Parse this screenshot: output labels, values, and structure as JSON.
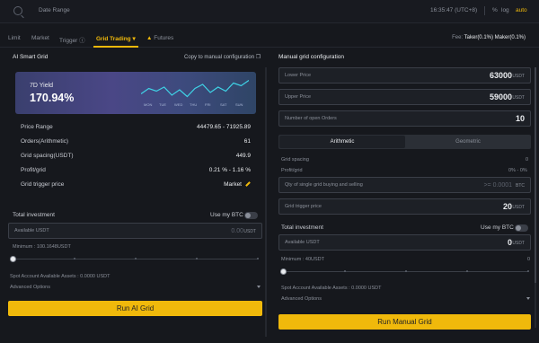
{
  "topbar": {
    "date_range": "Date Range",
    "time": "16:35:47 (UTC+8)",
    "pct": "%",
    "log": "log",
    "auto": "auto"
  },
  "tabs": [
    {
      "label": "Limit"
    },
    {
      "label": "Market"
    },
    {
      "label": "Trigger"
    },
    {
      "label": "Grid Trading"
    },
    {
      "label": "Futures"
    }
  ],
  "fee": {
    "prefix": "Fee:",
    "value": "Taker(0.1%) Maker(0.1%)"
  },
  "left": {
    "title": "AI Smart Grid",
    "copy_link": "Copy to manual configuration",
    "card": {
      "label": "7D Yield",
      "value": "170.94%",
      "days": [
        "MON",
        "TUE",
        "WED",
        "THU",
        "FRI",
        "SAT",
        "SUN"
      ],
      "sparkline": [
        0.35,
        0.55,
        0.45,
        0.6,
        0.3,
        0.5,
        0.25,
        0.55,
        0.7,
        0.4,
        0.6,
        0.45,
        0.75,
        0.65,
        0.85
      ]
    },
    "rows": [
      {
        "key": "Price Range",
        "value": "44479.65 - 71925.89"
      },
      {
        "key": "Orders(Arithmetic)",
        "value": "61"
      },
      {
        "key": "Grid spacing(USDT)",
        "value": "449.9"
      },
      {
        "key": "Profit/grid",
        "value": "0.21 % - 1.16 %"
      },
      {
        "key": "Grid trigger price",
        "value": "Market"
      }
    ],
    "total_investment": "Total investment",
    "use_btc": "Use my BTC",
    "available_label": "Available USDT",
    "available_value": "0.00",
    "available_unit": "USDT",
    "minimum": "Minimum : 100.1648USDT",
    "spot_assets": "Spot Account Available Assets : 0.0000 USDT",
    "advanced": "Advanced Options",
    "cta": "Run AI Grid"
  },
  "right": {
    "title": "Manual grid configuration",
    "lower_price": {
      "label": "Lower Price",
      "value": "63000",
      "unit": "USDT"
    },
    "upper_price": {
      "label": "Upper Price",
      "value": "59000",
      "unit": "USDT"
    },
    "orders": {
      "label": "Number of open Orders",
      "value": "10"
    },
    "seg": {
      "on": "Arithmetic",
      "off": "Geometric"
    },
    "grid_spacing": {
      "label": "Grid spacing",
      "value": "0"
    },
    "profit_grid": {
      "label": "Profit/grid",
      "value": "0% - 0%"
    },
    "qty": {
      "label": "Qty of single grid buying and selling",
      "value": ">= 0.0001",
      "unit": "BTC"
    },
    "trigger": {
      "label": "Grid trigger price",
      "value": "20",
      "unit": "USDT"
    },
    "total_investment": "Total investment",
    "use_btc": "Use my BTC",
    "available": {
      "label": "Available USDT",
      "value": "0",
      "unit": "USDT"
    },
    "minimum": "Minimum : 40USDT",
    "minimum_right": "0",
    "spot_assets": "Spot Account Available Assets : 0.0000 USDT",
    "advanced": "Advanced Options",
    "cta": "Run Manual Grid"
  },
  "colors": {
    "accent": "#f0b90b",
    "bg": "#16181d",
    "card_start": "#3a3f6e",
    "card_end": "#2f4566",
    "spark": "#3fd3e6"
  }
}
